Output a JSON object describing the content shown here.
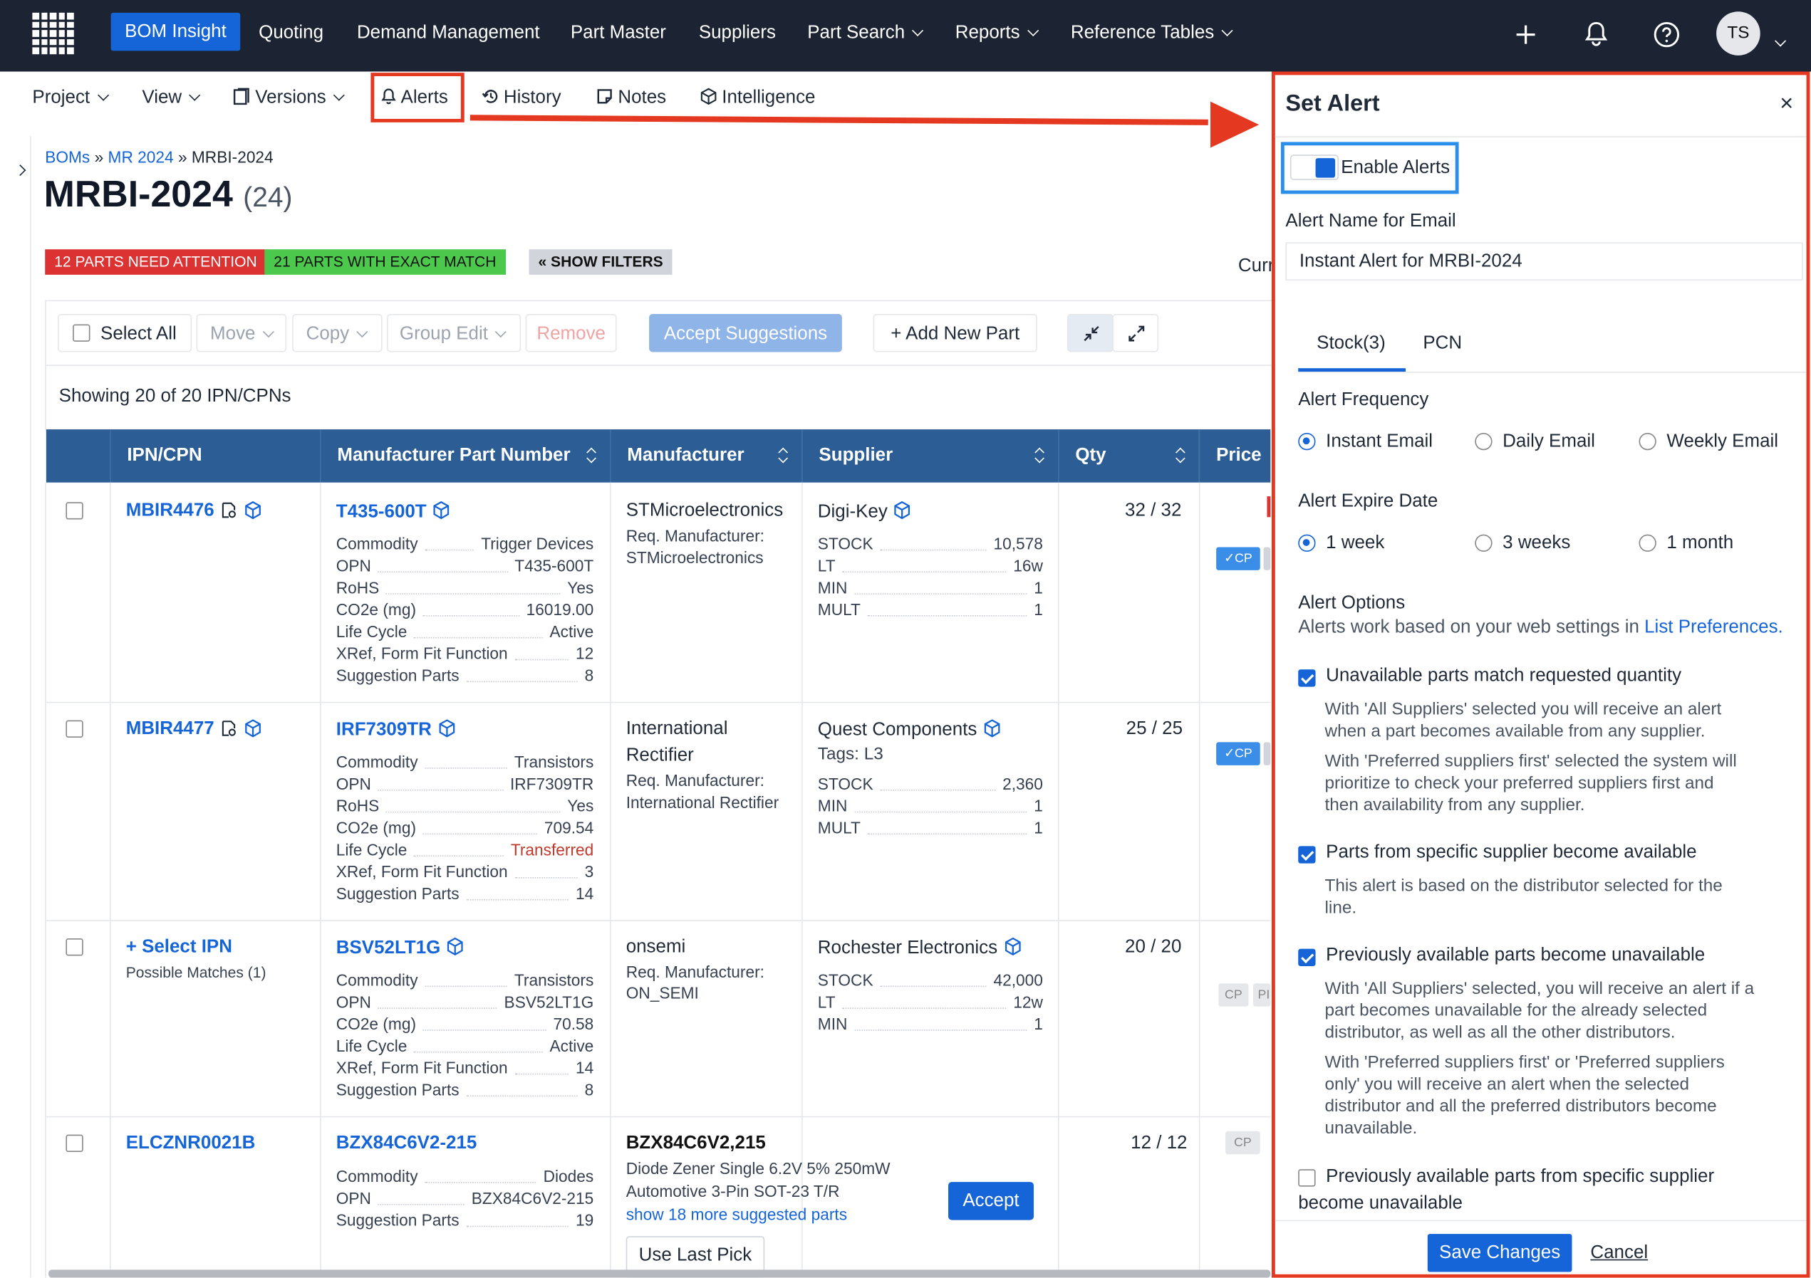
{
  "nav": {
    "items": [
      "BOM Insight",
      "Quoting",
      "Demand Management",
      "Part Master",
      "Suppliers",
      "Part Search",
      "Reports",
      "Reference Tables"
    ],
    "avatar_initials": "TS",
    "icons": [
      "grid-logo-icon",
      "plus-icon",
      "bell-icon",
      "help-icon",
      "chevron-down-icon"
    ]
  },
  "subnav": {
    "items": [
      "Project",
      "View",
      "Versions",
      "Alerts",
      "History",
      "Notes",
      "Intelligence"
    ]
  },
  "breadcrumb": {
    "root": "BOMs",
    "sep": "»",
    "mid": "MR 2024",
    "current": "MRBI-2024"
  },
  "page": {
    "title": "MRBI-2024",
    "count": "(24)",
    "cut_text": "Curr"
  },
  "badges": {
    "attention": "12 PARTS NEED ATTENTION",
    "exact": "21 PARTS WITH EXACT MATCH",
    "filters": "« SHOW FILTERS"
  },
  "colors": {
    "danger": "#dc3232",
    "success": "#4cc94c",
    "primary": "#1565d8",
    "header": "#2c5d94",
    "annotation_red": "#e53820"
  },
  "toolbar": {
    "select_all": "Select All",
    "move": "Move",
    "copy": "Copy",
    "group_edit": "Group Edit",
    "remove": "Remove",
    "accept": "Accept Suggestions",
    "add": "+ Add New Part"
  },
  "showing": "Showing 20 of 20 IPN/CPNs",
  "table": {
    "headers": [
      "IPN/CPN",
      "Manufacturer Part Number",
      "Manufacturer",
      "Supplier",
      "Qty",
      "Price"
    ],
    "rows": [
      {
        "ipn": "MBIR4476",
        "mpn": "T435-600T",
        "attrs": [
          {
            "k": "Commodity",
            "v": "Trigger Devices"
          },
          {
            "k": "OPN",
            "v": "T435-600T"
          },
          {
            "k": "RoHS",
            "v": "Yes"
          },
          {
            "k": "CO2e (mg)",
            "v": "16019.00"
          },
          {
            "k": "Life Cycle",
            "v": "Active"
          },
          {
            "k": "XRef, Form Fit Function",
            "v": "12"
          },
          {
            "k": "Suggestion Parts",
            "v": "8"
          }
        ],
        "manufacturer": "STMicroelectronics",
        "req_label": "Req. Manufacturer:",
        "req_value": "STMicroelectronics",
        "supplier": "Digi-Key",
        "supplier_tags": "",
        "stock": [
          {
            "k": "STOCK",
            "v": "10,578"
          },
          {
            "k": "LT",
            "v": "16w"
          },
          {
            "k": "MIN",
            "v": "1"
          },
          {
            "k": "MULT",
            "v": "1"
          }
        ],
        "qty": "32 / 32",
        "cp": "✓CP"
      },
      {
        "ipn": "MBIR4477",
        "mpn": "IRF7309TR",
        "attrs": [
          {
            "k": "Commodity",
            "v": "Transistors"
          },
          {
            "k": "OPN",
            "v": "IRF7309TR"
          },
          {
            "k": "RoHS",
            "v": "Yes"
          },
          {
            "k": "CO2e (mg)",
            "v": "709.54"
          },
          {
            "k": "Life Cycle",
            "v": "Transferred"
          },
          {
            "k": "XRef, Form Fit Function",
            "v": "3"
          },
          {
            "k": "Suggestion Parts",
            "v": "14"
          }
        ],
        "manufacturer_l1": "International",
        "manufacturer_l2": "Rectifier",
        "req_label": "Req. Manufacturer:",
        "req_value": "International Rectifier",
        "supplier": "Quest Components",
        "supplier_tags": "Tags: L3",
        "stock": [
          {
            "k": "STOCK",
            "v": "2,360"
          },
          {
            "k": "MIN",
            "v": "1"
          },
          {
            "k": "MULT",
            "v": "1"
          }
        ],
        "qty": "25 / 25",
        "cp": "✓CP"
      },
      {
        "ipn": "+ Select IPN",
        "ipn_sub": "Possible Matches (1)",
        "mpn": "BSV52LT1G",
        "attrs": [
          {
            "k": "Commodity",
            "v": "Transistors"
          },
          {
            "k": "OPN",
            "v": "BSV52LT1G"
          },
          {
            "k": "CO2e (mg)",
            "v": "70.58"
          },
          {
            "k": "Life Cycle",
            "v": "Active"
          },
          {
            "k": "XRef, Form Fit Function",
            "v": "14"
          },
          {
            "k": "Suggestion Parts",
            "v": "8"
          }
        ],
        "manufacturer": "onsemi",
        "req_label": "Req. Manufacturer:",
        "req_value": "ON_SEMI",
        "supplier": "Rochester Electronics",
        "stock": [
          {
            "k": "STOCK",
            "v": "42,000"
          },
          {
            "k": "LT",
            "v": "12w"
          },
          {
            "k": "MIN",
            "v": "1"
          }
        ],
        "qty": "20 / 20",
        "cp": "CP",
        "cp2": "PI"
      },
      {
        "ipn": "ELCZNR0021B",
        "mpn": "BZX84C6V2-215",
        "attrs": [
          {
            "k": "Commodity",
            "v": "Diodes"
          },
          {
            "k": "OPN",
            "v": "BZX84C6V2-215"
          },
          {
            "k": "Suggestion Parts",
            "v": "19"
          }
        ],
        "suggest_title": "BZX84C6V2,215",
        "suggest_desc_l1": "Diode Zener Single 6.2V 5% 250mW",
        "suggest_desc_l2": "Automotive 3-Pin SOT-23 T/R",
        "suggest_more": "show 18 more suggested parts",
        "accept": "Accept",
        "use_last": "Use Last Pick",
        "qty": "12 / 12",
        "cp": "CP"
      }
    ]
  },
  "panel": {
    "title": "Set Alert",
    "close": "×",
    "enable": "Enable Alerts",
    "enabled": true,
    "name_label": "Alert Name for Email",
    "name_value": "Instant Alert for MRBI-2024",
    "tabs": [
      "Stock(3)",
      "PCN"
    ],
    "freq_label": "Alert Frequency",
    "freq": [
      "Instant Email",
      "Daily Email",
      "Weekly Email"
    ],
    "freq_selected": "Instant Email",
    "expire_label": "Alert Expire Date",
    "expire": [
      "1 week",
      "3 weeks",
      "1 month"
    ],
    "expire_selected": "1 week",
    "options_label": "Alert Options",
    "options_note": "Alerts work based on your web settings in",
    "options_link": "List Preferences.",
    "opt1": "Unavailable parts match requested quantity",
    "opt1_d1_l1": "With 'All Suppliers' selected you will receive an alert",
    "opt1_d1_l2": "when a part becomes available from any supplier.",
    "opt1_d2_l1": "With 'Preferred suppliers first' selected the system will",
    "opt1_d2_l2": "prioritize to check your preferred suppliers first and",
    "opt1_d2_l3": "then availability from any supplier.",
    "opt2": "Parts from specific supplier become available",
    "opt2_d_l1": "This alert is based on the distributor selected for the",
    "opt2_d_l2": "line.",
    "opt3": "Previously available parts become unavailable",
    "opt3_d1_l1": "With 'All Suppliers' selected, you will receive an alert if a",
    "opt3_d1_l2": "part becomes unavailable for the already selected",
    "opt3_d1_l3": "distributor, as well as all the other distributors.",
    "opt3_d2_l1": "With 'Preferred suppliers first' or 'Preferred suppliers",
    "opt3_d2_l2": "only' you will receive an alert when the selected",
    "opt3_d2_l3": "distributor and all the preferred distributors become",
    "opt3_d2_l4": "unavailable.",
    "opt4_l1": "Previously available parts from specific supplier",
    "opt4_l2": "become unavailable",
    "save": "Save Changes",
    "cancel": "Cancel"
  }
}
